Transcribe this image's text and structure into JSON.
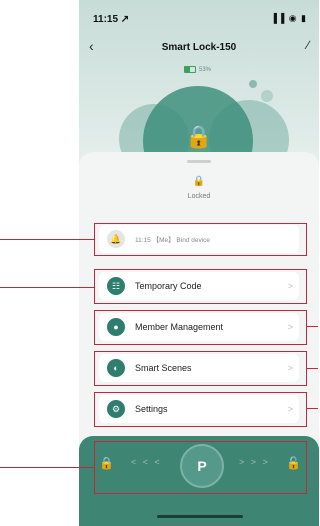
{
  "status_bar": {
    "time": "11:15 ↗",
    "icons": "▐▐ ◉ ▮"
  },
  "nav": {
    "back_icon": "‹",
    "title": "Smart Lock-150",
    "edit_icon": "∕"
  },
  "battery": {
    "percent_label": "53%",
    "level": 0.53,
    "color": "#3fa05a"
  },
  "hero": {
    "lock_glyph": "🔒"
  },
  "lock_status": {
    "icon": "🔒",
    "label": "Locked"
  },
  "log": {
    "icon": "🔔",
    "text": "11:15 【Me】 Bind device"
  },
  "menu": [
    {
      "icon": "☷",
      "label": "Temporary Code",
      "chevron": ">"
    },
    {
      "icon": "●",
      "label": "Member Management",
      "chevron": ">"
    },
    {
      "icon": "◐",
      "label": "Smart Scenes",
      "chevron": ">"
    },
    {
      "icon": "⚙",
      "label": "Settings",
      "chevron": ">"
    }
  ],
  "control": {
    "lock_icon": "🔒",
    "arrows_left": "< < <",
    "key_icon": "P",
    "arrows_right": "> > >",
    "unlock_icon": "🔓"
  },
  "colors": {
    "accent": "#3e8573",
    "callout": "#c0283d"
  }
}
